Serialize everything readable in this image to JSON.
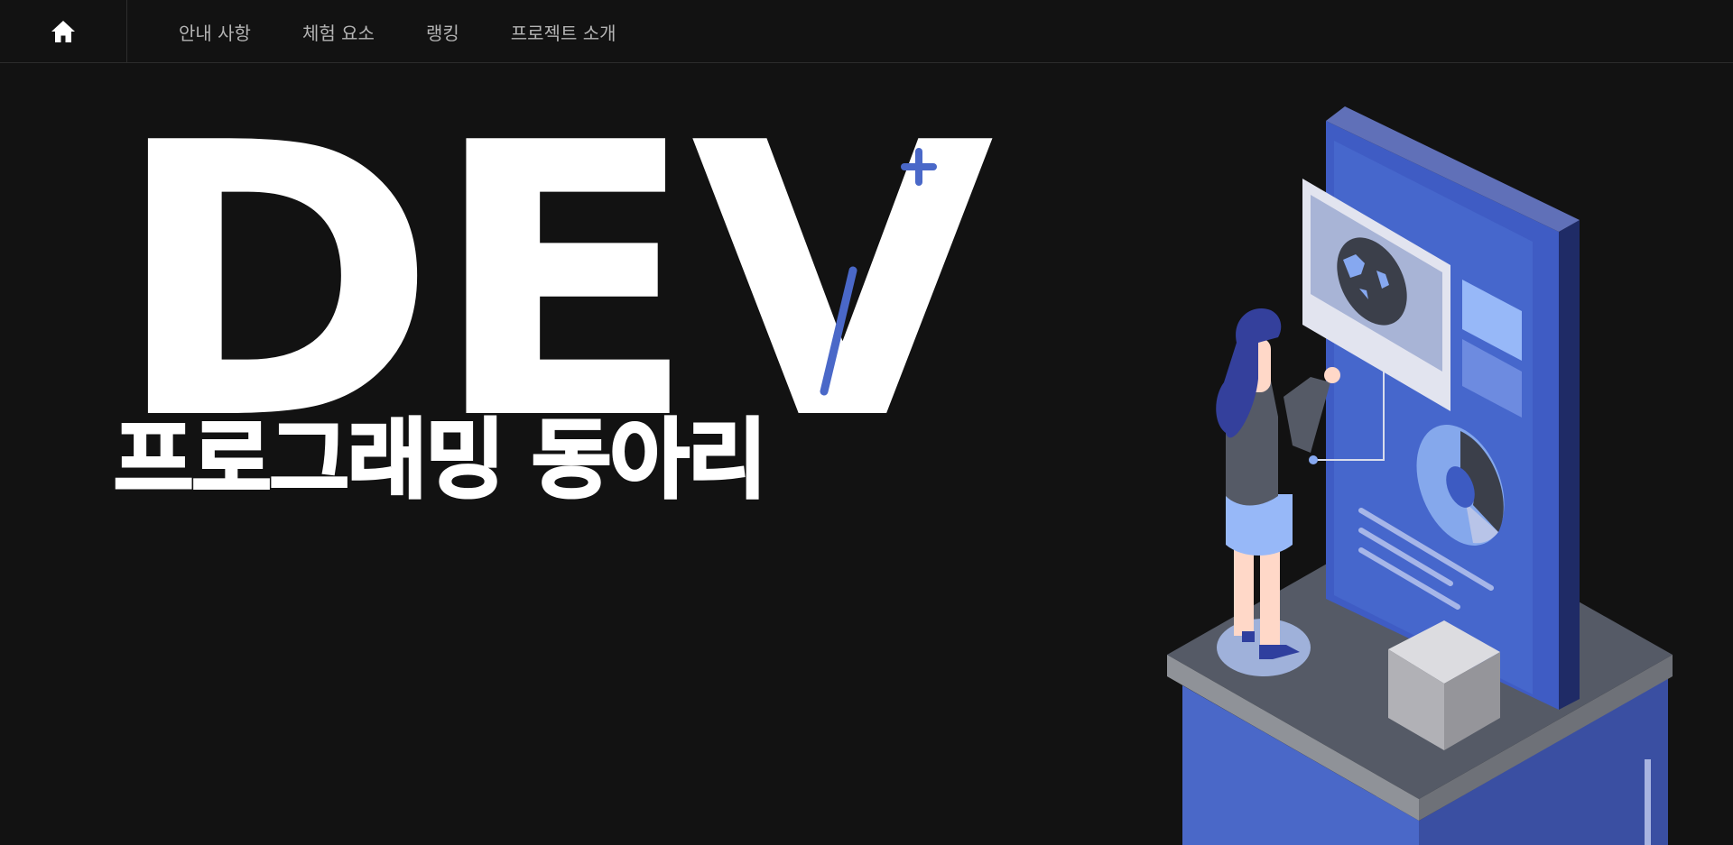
{
  "nav": {
    "home_icon": "home-icon",
    "items": [
      {
        "label": "안내 사항"
      },
      {
        "label": "체험 요소"
      },
      {
        "label": "랭킹"
      },
      {
        "label": "프로젝트 소개"
      }
    ]
  },
  "hero": {
    "title": "DEV",
    "subtitle": "프로그래밍 동아리",
    "accent_color": "#4a68c8"
  },
  "colors": {
    "background": "#121212",
    "nav_text": "#b4b4b4",
    "hero_text": "#ffffff"
  }
}
